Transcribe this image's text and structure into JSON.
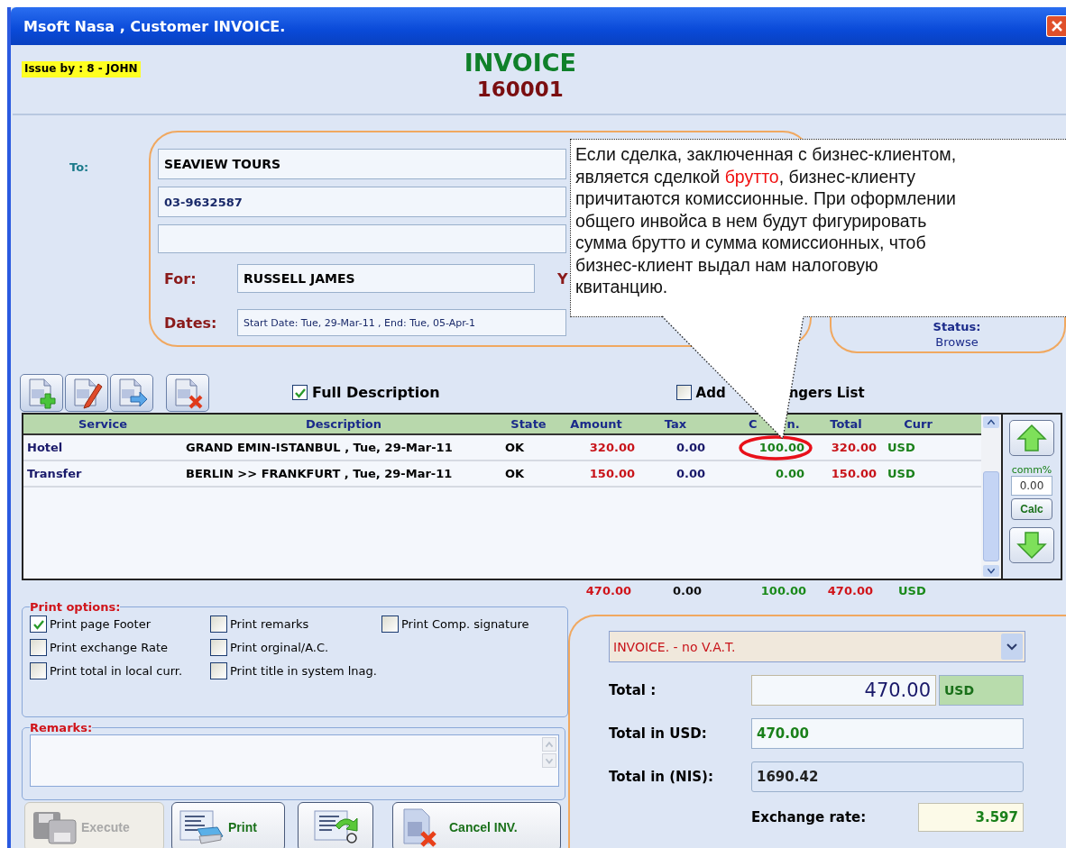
{
  "window": {
    "title": "Msoft Nasa , Customer INVOICE."
  },
  "header": {
    "issued_by": "Issue by : 8 - JOHN",
    "doc_type": "INVOICE",
    "number": "160001"
  },
  "customer": {
    "to_label": "To:",
    "name": "SEAVIEW TOURS",
    "phone": "03-9632587",
    "for_label": "For:",
    "passenger": "RUSSELL JAMES",
    "label_cut": "Y",
    "dates_label": "Dates:",
    "dates": "Start Date: Tue, 29-Mar-11 , End: Tue, 05-Apr-1"
  },
  "status": {
    "label": "Status:",
    "value": "Browse"
  },
  "toolbar": [
    {
      "kind": "add"
    },
    {
      "kind": "edit"
    },
    {
      "kind": "copy"
    },
    {
      "kind": "delete"
    }
  ],
  "full_description": {
    "label": "Full Description",
    "checked": true
  },
  "passengers_list": {
    "label_start": "Add",
    "label_end": "ngers List",
    "checked": false
  },
  "table": {
    "columns": [
      {
        "label": "Service"
      },
      {
        "label": "Description"
      },
      {
        "label": "State"
      },
      {
        "label": "Amount"
      },
      {
        "label": "Tax"
      },
      {
        "label_start": "C",
        "label_end": "n."
      },
      {
        "label": "Total"
      },
      {
        "label": "Curr"
      }
    ],
    "rows": [
      {
        "cells": [
          "Hotel",
          "GRAND EMIN-ISTANBUL , Tue, 29-Mar-11",
          "OK",
          "320.00",
          "0.00",
          "100.00",
          "320.00",
          "USD"
        ],
        "circled": true
      },
      {
        "cells": [
          "Transfer",
          "BERLIN >> FRANKFURT , Tue, 29-Mar-11",
          "OK",
          "150.00",
          "0.00",
          "0.00",
          "150.00",
          "USD"
        ],
        "circled": false
      }
    ]
  },
  "side_panel": {
    "comm_label": "comm%",
    "comm_value": "0.00",
    "calc": "Calc"
  },
  "totals": [
    "470.00",
    "0.00",
    "100.00",
    "470.00",
    "USD"
  ],
  "print_options": {
    "title": "Print options:",
    "rows": [
      [
        {
          "label": "Print page Footer",
          "checked": true
        },
        {
          "label": "Print remarks",
          "checked": false
        },
        {
          "label": "Print Comp. signature",
          "checked": false
        }
      ],
      [
        {
          "label": "Print exchange Rate",
          "checked": false
        },
        {
          "label": "Print orginal/A.C.",
          "checked": false
        }
      ],
      [
        {
          "label": "Print total in local curr.",
          "checked": false
        },
        {
          "label": "Print title in system lnag.",
          "checked": false
        }
      ]
    ]
  },
  "remarks": {
    "title": "Remarks:"
  },
  "actions": [
    {
      "kind": "execute",
      "label": "Execute",
      "disabled": true
    },
    {
      "kind": "print",
      "label": "Print",
      "disabled": false
    },
    {
      "kind": "email",
      "disabled": false
    },
    {
      "kind": "cancel",
      "label": "Cancel INV.",
      "disabled": false
    }
  ],
  "summary": {
    "doc_kind": "INVOICE. - no V.A.T.",
    "total_label": "Total :",
    "total": "470.00",
    "currency": "USD",
    "usd_label": "Total in USD:",
    "usd": "470.00",
    "local_label": "Total in (NIS):",
    "local": "1690.42",
    "rate_label": "Exchange rate:",
    "rate": "3.597"
  },
  "callout": {
    "segments": [
      {
        "text": "Если сделка, заключенная с бизнес-клиентом,\nявляется сделкой ",
        "highlight": false
      },
      {
        "text": "брутто",
        "highlight": true
      },
      {
        "text": ", бизнес-клиенту\nпричитаются комиссионные. При оформлении\nобщего инвойса в нем будут фигурировать\nсумма брутто и сумма комиссионных, чтоб\nбизнес-клиент выдал нам налоговую\nквитанцию.",
        "highlight": false
      }
    ]
  }
}
